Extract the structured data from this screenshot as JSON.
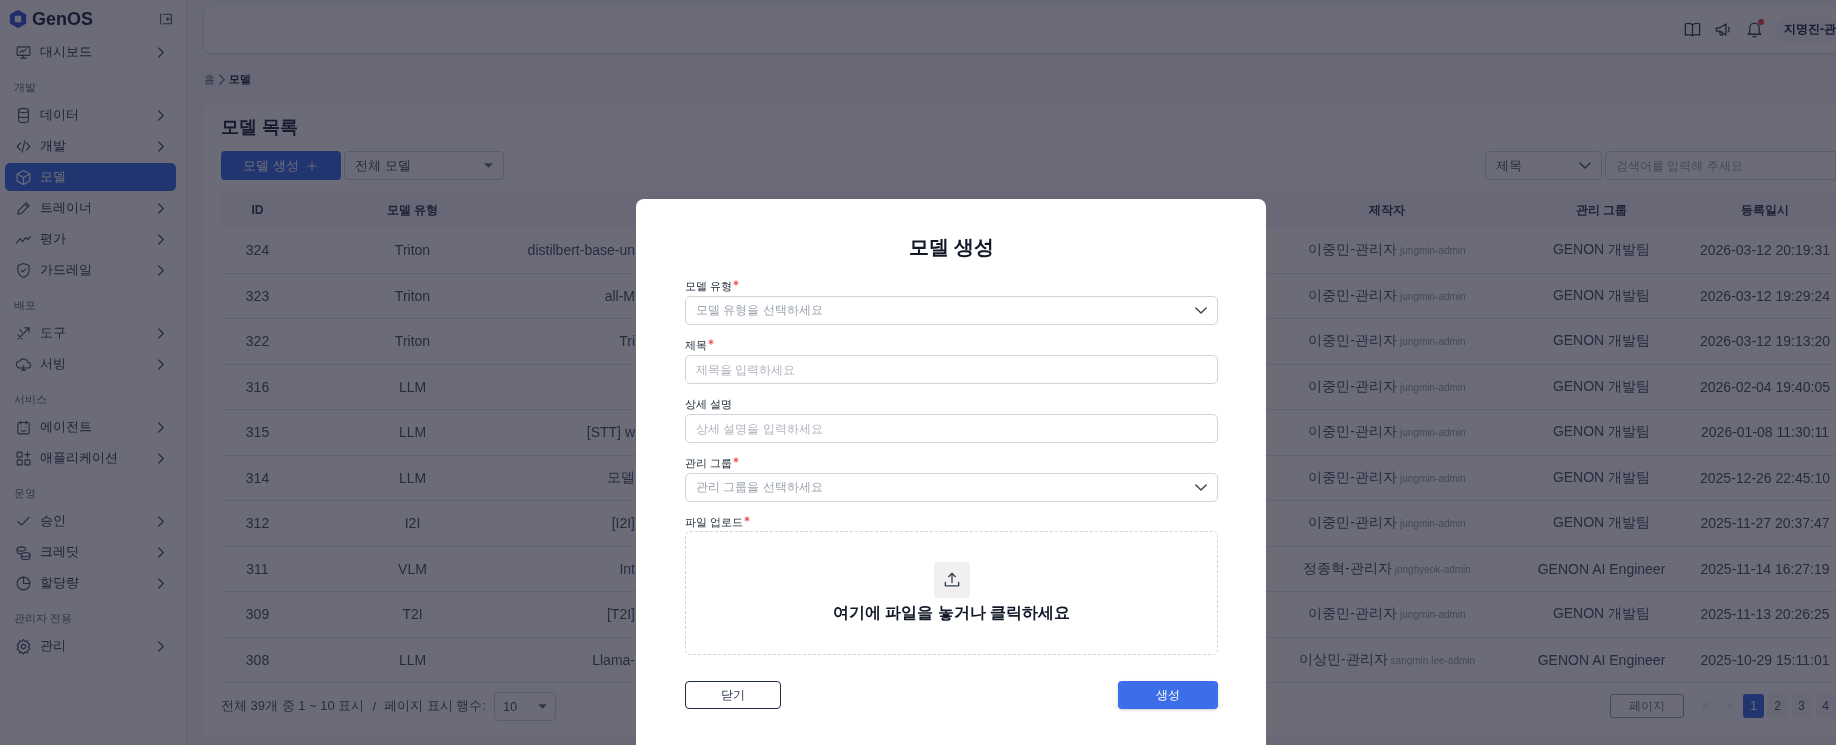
{
  "sidebar": {
    "logo": "GenOS",
    "sections": [
      {
        "items": [
          {
            "label": "대시보드",
            "selected": false,
            "submenu": true
          }
        ]
      },
      {
        "label": "개발",
        "items": [
          {
            "label": "데이터",
            "selected": false,
            "submenu": true
          },
          {
            "label": "개발",
            "selected": false,
            "submenu": true
          },
          {
            "label": "모델",
            "selected": true,
            "submenu": false
          },
          {
            "label": "트레이너",
            "selected": false,
            "submenu": true
          },
          {
            "label": "평가",
            "selected": false,
            "submenu": true
          },
          {
            "label": "가드레일",
            "selected": false,
            "submenu": true
          }
        ]
      },
      {
        "label": "배포",
        "items": [
          {
            "label": "도구",
            "selected": false,
            "submenu": true
          },
          {
            "label": "서빙",
            "selected": false,
            "submenu": true
          }
        ]
      },
      {
        "label": "서비스",
        "items": [
          {
            "label": "에이전트",
            "selected": false,
            "submenu": true
          },
          {
            "label": "애플리케이션",
            "selected": false,
            "submenu": true
          }
        ]
      },
      {
        "label": "운영",
        "items": [
          {
            "label": "승인",
            "selected": false,
            "submenu": true
          },
          {
            "label": "크레딧",
            "selected": false,
            "submenu": true
          },
          {
            "label": "할당량",
            "selected": false,
            "submenu": true
          }
        ]
      },
      {
        "label": "관리자 전용",
        "items": [
          {
            "label": "관리",
            "selected": false,
            "submenu": true
          }
        ]
      }
    ]
  },
  "header": {
    "user": "지명진-관",
    "notification_unread": true
  },
  "breadcrumb": [
    "홈",
    "모델"
  ],
  "page": {
    "title": "모델 목록",
    "create_button": "모델 생성",
    "model_filter": "전체 모델",
    "search_field": "제목",
    "search_placeholder": "검색어를 입력해 주세요"
  },
  "table": {
    "columns": [
      "ID",
      "모델 유형",
      "제작자",
      "관리 그룹",
      "등록일시"
    ],
    "rows": [
      {
        "id": "324",
        "model_type": "Triton",
        "column_3": "distilbert-base-un",
        "creator": {
          "name": "이중민-관리자",
          "username": "jungmin-admin"
        },
        "group": "GENON 개발팀",
        "created_at": "2026-03-12 20:19:31"
      },
      {
        "id": "323",
        "model_type": "Triton",
        "column_3": "all-M",
        "creator": {
          "name": "이중민-관리자",
          "username": "jungmin-admin"
        },
        "group": "GENON 개발팀",
        "created_at": "2026-03-12 19:29:24"
      },
      {
        "id": "322",
        "model_type": "Triton",
        "column_3": "Tri",
        "creator": {
          "name": "이중민-관리자",
          "username": "jungmin-admin"
        },
        "group": "GENON 개발팀",
        "created_at": "2026-03-12 19:13:20"
      },
      {
        "id": "316",
        "model_type": "LLM",
        "creator": {
          "name": "이중민-관리자",
          "username": "jungmin-admin"
        },
        "group": "GENON 개발팀",
        "created_at": "2026-02-04 19:40:05"
      },
      {
        "id": "315",
        "model_type": "LLM",
        "column_3": "[STT] w",
        "creator": {
          "name": "이중민-관리자",
          "username": "jungmin-admin"
        },
        "group": "GENON 개발팀",
        "created_at": "2026-01-08 11:30:11"
      },
      {
        "id": "314",
        "model_type": "LLM",
        "column_3": "모델",
        "creator": {
          "name": "이중민-관리자",
          "username": "jungmin-admin"
        },
        "group": "GENON 개발팀",
        "created_at": "2025-12-26 22:45:10"
      },
      {
        "id": "312",
        "model_type": "I2I",
        "column_3": "[I2I]",
        "creator": {
          "name": "이중민-관리자",
          "username": "jungmin-admin"
        },
        "group": "GENON 개발팀",
        "created_at": "2025-11-27 20:37:47"
      },
      {
        "id": "311",
        "model_type": "VLM",
        "column_3": "Int",
        "creator": {
          "name": "정종혁-관리자",
          "username": "jonghyeok-admin"
        },
        "group": "GENON AI Engineer",
        "created_at": "2025-11-14 16:27:19"
      },
      {
        "id": "309",
        "model_type": "T2I",
        "column_3": "[T2I]",
        "creator": {
          "name": "이중민-관리자",
          "username": "jungmin-admin"
        },
        "group": "GENON 개발팀",
        "created_at": "2025-11-13 20:26:25"
      },
      {
        "id": "308",
        "model_type": "LLM",
        "column_3": "Llama-",
        "creator": {
          "name": "이상민-관리자",
          "username": "sangmin.lee-admin"
        },
        "group": "GENON AI Engineer",
        "created_at": "2025-10-29 15:11:01"
      }
    ]
  },
  "footer": {
    "summary": "전체 39개 중 1 ~ 10 표시",
    "separator": "/",
    "page_size_label": "페이지 표시 행수:",
    "page_size": "10"
  },
  "pagination": {
    "jump_placeholder": "페이지",
    "first": {
      "disabled": true
    },
    "prev": {
      "disabled": true
    },
    "pages": [
      {
        "label": "1",
        "selected": true
      },
      {
        "label": "2",
        "selected": false
      },
      {
        "label": "3",
        "selected": false
      },
      {
        "label": "4",
        "selected": false
      }
    ]
  },
  "modal": {
    "title": "모델 생성",
    "fields": [
      {
        "kind": "select",
        "label": "모델 유형",
        "required": true,
        "placeholder": "모델 유형을 선택하세요"
      },
      {
        "kind": "text",
        "label": "제목",
        "required": true,
        "placeholder": "제목을 입력하세요"
      },
      {
        "kind": "text",
        "label": "상세 설명",
        "required": false,
        "placeholder": "상세 설명을 입력하세요"
      },
      {
        "kind": "select",
        "label": "관리 그룹",
        "required": true,
        "placeholder": "관리 그룹을 선택하세요"
      },
      {
        "kind": "upload",
        "label": "파일 업로드",
        "required": true,
        "prompt": "여기에 파일을 놓거나 클릭하세요"
      }
    ],
    "buttons": [
      {
        "kind": "secondary",
        "label": "닫기"
      },
      {
        "kind": "primary",
        "label": "생성"
      }
    ]
  }
}
